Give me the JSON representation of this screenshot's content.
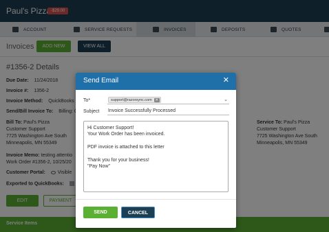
{
  "app": {
    "brand": "Paul's Pizza",
    "balance_badge": "-$29.00"
  },
  "nav": {
    "items": [
      {
        "label": "ACCOUNT",
        "icon": "user-icon"
      },
      {
        "label": "SERVICE REQUESTS",
        "icon": "wrench-icon"
      },
      {
        "label": "INVOICES",
        "icon": "invoice-icon",
        "active": true
      },
      {
        "label": "DEPOSITS",
        "icon": "deposit-icon"
      },
      {
        "label": "QUOTES",
        "icon": "quote-icon"
      }
    ]
  },
  "toolbar": {
    "title": "Invoices",
    "add_new": "ADD NEW",
    "view_all": "VIEW ALL"
  },
  "invoice": {
    "heading": "#1356-2 Details",
    "due_date_label": "Due Date:",
    "due_date": "11/24/2018",
    "number_label": "Invoice #:",
    "number": "1356-2",
    "method_label": "Invoice Method:",
    "method": "QuickBooks D",
    "send_bill_label": "Send/Bill Invoice To:",
    "send_bill": "Billing: Cu",
    "bill_to_label": "Bill To:",
    "bill_to_name": "Paul's Pizza",
    "bill_to_contact": "Customer Support",
    "bill_to_street": "7725 Washington Ave South",
    "bill_to_city": "Minneapolis, MN 55349",
    "service_to_label": "Service To:",
    "service_to_name": "Paul's Pizza",
    "service_to_contact": "Customer Support",
    "service_to_street": "7725 Washington Ave South",
    "service_to_city": "Minneapolis, MN 55349",
    "memo_label": "Invoice Memo:",
    "memo_line1": "testing attentio",
    "memo_line2": "Work Order #1356-2, 10/25/20",
    "portal_label": "Customer Portal:",
    "portal_value": "Visible",
    "exported_label": "Exported to QuickBooks:",
    "edit": "EDIT",
    "payment": "PAYMENT",
    "service_items": "Service Items"
  },
  "email_modal": {
    "title": "Send Email",
    "close_glyph": "✕",
    "to_label": "To*",
    "to_chip": "support@razorsync.com",
    "chip_remove": "✕",
    "caret": "⌄",
    "subject_label": "Subject",
    "subject": "Invoice Successfully Processed",
    "body": {
      "line1": "Hi Customer Support!",
      "line2": "Your Work Order has been invoiced.",
      "line3": "PDF invoice is attached to this letter",
      "line4": "Thank you for your business!",
      "line5": "\"Pay Now\""
    },
    "send": "SEND",
    "cancel": "CANCEL"
  },
  "colors": {
    "header": "#1c3f54",
    "accent_green": "#5ab033",
    "modal_header": "#1f6fa8",
    "badge_red": "#d9534f"
  }
}
